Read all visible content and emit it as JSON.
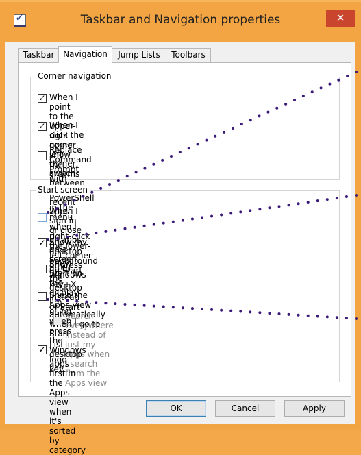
{
  "window": {
    "title": "Taskbar and Navigation properties",
    "close_glyph": "✕",
    "icon_check": "✓"
  },
  "tabs": [
    {
      "label": "Taskbar"
    },
    {
      "label": "Navigation"
    },
    {
      "label": "Jump Lists"
    },
    {
      "label": "Toolbars"
    }
  ],
  "corner": {
    "legend": "Corner navigation",
    "options": [
      {
        "label": "When I point to the upper-right corner, show the charms",
        "checked": true
      },
      {
        "label": "When I click the upper-left corner, switch between my recent apps",
        "checked": true
      },
      {
        "label": "Replace Command Prompt with Windows PowerShell in the menu\nwhen I right-click the lower-left corner or press Windows key+X",
        "checked": false
      }
    ]
  },
  "start": {
    "legend": "Start screen",
    "options": [
      {
        "label": "When I sign in or close all apps on a screen, go to the desktop\ninstead of Start",
        "checked": false
      },
      {
        "label": "Show my desktop background on Start",
        "checked": true
      },
      {
        "label": "Show Start on the display I'm using when I press the Windows logo\nkey",
        "checked": false
      },
      {
        "label": "Show the Apps view automatically when I go to Start",
        "checked": false
      },
      {
        "label": "Search everywhere instead of just my apps when I search\nfrom the Apps view",
        "checked": false,
        "disabled": true
      },
      {
        "label": "List desktop apps first in the Apps view when it's sorted by\ncategory",
        "checked": true
      }
    ]
  },
  "buttons": {
    "ok": "OK",
    "cancel": "Cancel",
    "apply": "Apply"
  },
  "colors": {
    "accent_orange": "#f3a443",
    "close_red": "#c9452d",
    "dot_purple": "#3b1a7a"
  }
}
